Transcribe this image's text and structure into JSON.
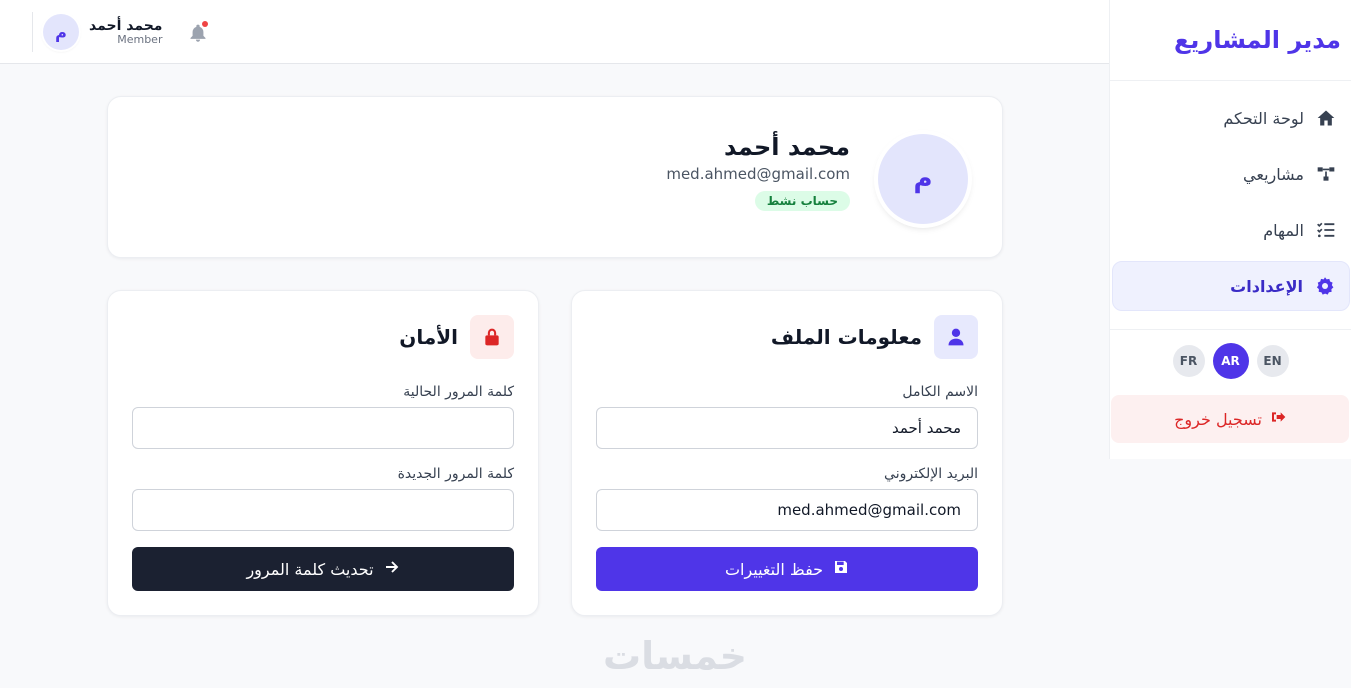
{
  "app": {
    "brand": "مدير المشاريع"
  },
  "sidebar": {
    "items": [
      {
        "label": "لوحة التحكم",
        "icon": "home-icon"
      },
      {
        "label": "مشاريعي",
        "icon": "project-diagram-icon"
      },
      {
        "label": "المهام",
        "icon": "tasks-list-icon"
      },
      {
        "label": "الإعدادات",
        "icon": "gear-icon",
        "active": true
      }
    ],
    "languages": [
      {
        "code": "FR"
      },
      {
        "code": "AR",
        "active": true
      },
      {
        "code": "EN"
      }
    ],
    "logout_label": "تسجيل خروج"
  },
  "header": {
    "user_name": "محمد أحمد",
    "user_role": "Member",
    "avatar_initial": "م",
    "has_notification": true
  },
  "profile": {
    "avatar_initial": "م",
    "name": "محمد أحمد",
    "email": "med.ahmed@gmail.com",
    "status": "حساب نشط"
  },
  "profile_info": {
    "title": "معلومات الملف",
    "full_name_label": "الاسم الكامل",
    "full_name_value": "محمد أحمد",
    "email_label": "البريد الإلكتروني",
    "email_value": "med.ahmed@gmail.com",
    "save_label": "حفظ التغييرات"
  },
  "security": {
    "title": "الأمان",
    "current_password_label": "كلمة المرور الحالية",
    "current_password_value": "",
    "new_password_label": "كلمة المرور الجديدة",
    "new_password_value": "",
    "update_label": "تحديث كلمة المرور"
  },
  "footer": {
    "logo_text": "خمسات"
  },
  "colors": {
    "accent": "#4f35e8",
    "dark_button": "#1b2131",
    "danger": "#dc2626",
    "success_bg": "#dcfce7",
    "success_text": "#15803d"
  }
}
